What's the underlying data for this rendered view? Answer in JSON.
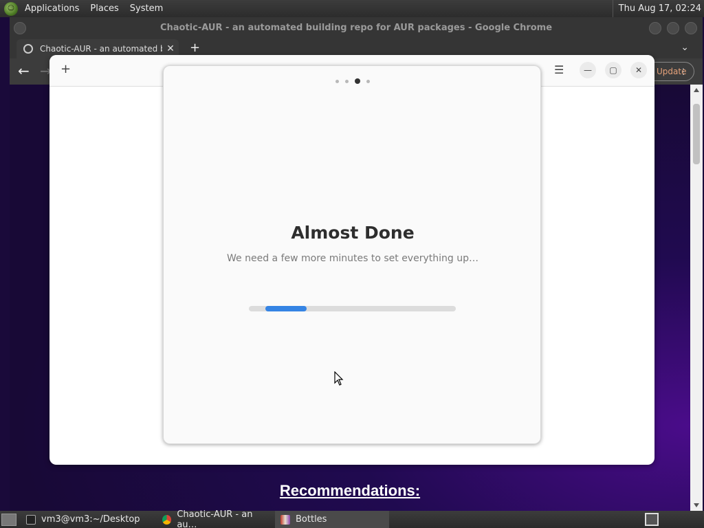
{
  "top_panel": {
    "menus": [
      "Applications",
      "Places",
      "System"
    ],
    "clock": "Thu Aug 17, 02:24"
  },
  "chrome": {
    "window_title": "Chaotic-AUR - an automated building repo for AUR packages - Google Chrome",
    "tab_title": "Chaotic-AUR - an automated building repo for AUR packages",
    "update_label": "Update",
    "page_heading": "Recommendations:"
  },
  "bottles": {
    "title": "Almost Done",
    "subtitle": "We need a few more minutes to set everything up…",
    "pager": {
      "pages": 4,
      "current": 3
    },
    "progress": {
      "start": 0.08,
      "fraction": 0.2
    }
  },
  "taskbar": {
    "tasks": [
      "vm3@vm3:~/Desktop",
      "Chaotic-AUR - an au…",
      "Bottles"
    ]
  },
  "icons": [
    "mint-logo-icon",
    "globe-icon",
    "close-icon",
    "plus-icon",
    "chevron-down-icon",
    "back-arrow-icon",
    "forward-arrow-icon",
    "kebab-menu-icon",
    "hamburger-menu-icon",
    "minimize-icon",
    "maximize-icon",
    "terminal-icon",
    "chrome-icon",
    "bottles-icon",
    "mouse-cursor-icon"
  ],
  "colors": {
    "accent": "#3584e4",
    "panel": "#3c3c3c",
    "page_bg": "#1a0a3a"
  }
}
